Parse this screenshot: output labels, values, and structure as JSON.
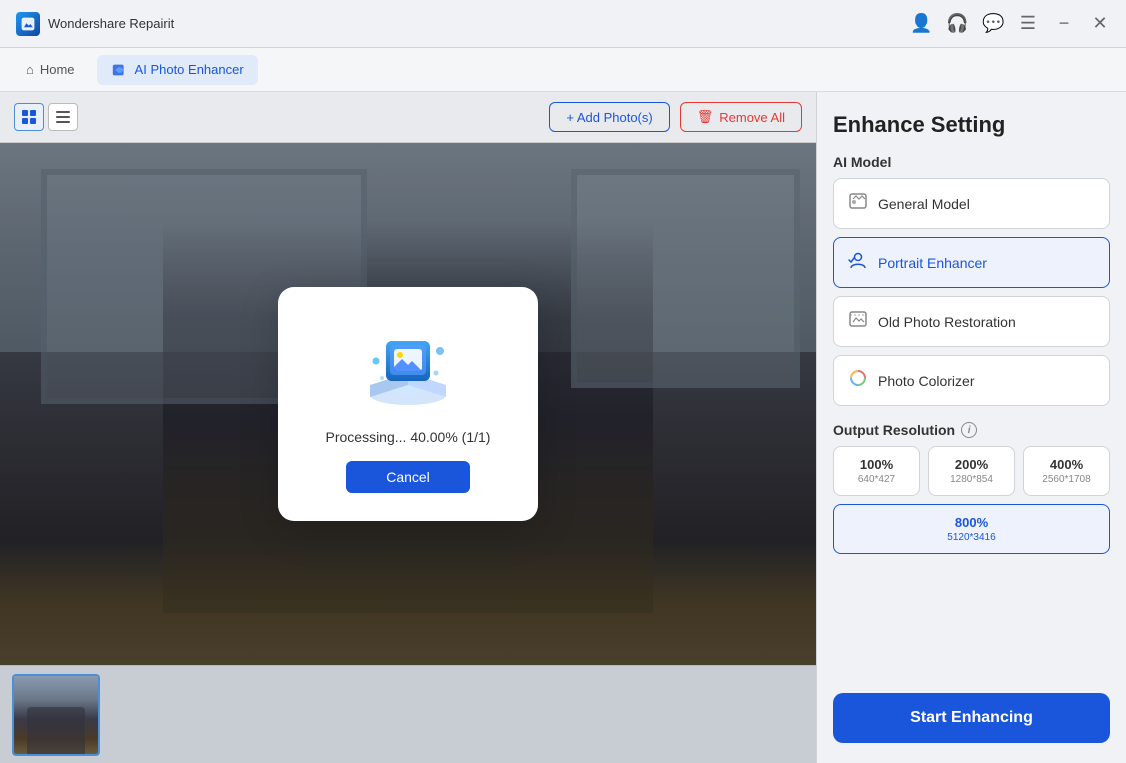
{
  "app": {
    "name": "Wondershare Repairit"
  },
  "nav": {
    "home_label": "Home",
    "tab_label": "AI Photo Enhancer"
  },
  "toolbar": {
    "add_label": "+ Add Photo(s)",
    "remove_label": "Remove All"
  },
  "dialog": {
    "processing_text": "Processing... 40.00% (1/1)",
    "cancel_label": "Cancel"
  },
  "panel": {
    "title": "Enhance Setting",
    "ai_model_label": "AI Model",
    "models": [
      {
        "id": "general",
        "label": "General Model",
        "active": false
      },
      {
        "id": "portrait",
        "label": "Portrait Enhancer",
        "active": true
      },
      {
        "id": "old-photo",
        "label": "Old Photo Restoration",
        "active": false
      },
      {
        "id": "colorizer",
        "label": "Photo Colorizer",
        "active": false
      }
    ],
    "resolution_label": "Output Resolution",
    "resolutions": [
      {
        "pct": "100%",
        "dims": "640*427",
        "active": false
      },
      {
        "pct": "200%",
        "dims": "1280*854",
        "active": false
      },
      {
        "pct": "400%",
        "dims": "2560*1708",
        "active": false
      }
    ],
    "resolution_selected": {
      "pct": "800%",
      "dims": "5120*3416",
      "active": true
    },
    "start_label": "Start Enhancing"
  },
  "icons": {
    "grid": "⊞",
    "list": "☰",
    "add": "+",
    "trash": "🗑",
    "home": "⌂",
    "user": "👤",
    "headphone": "🎧",
    "chat": "💬",
    "menu": "☰",
    "minimize": "−",
    "close": "✕"
  }
}
